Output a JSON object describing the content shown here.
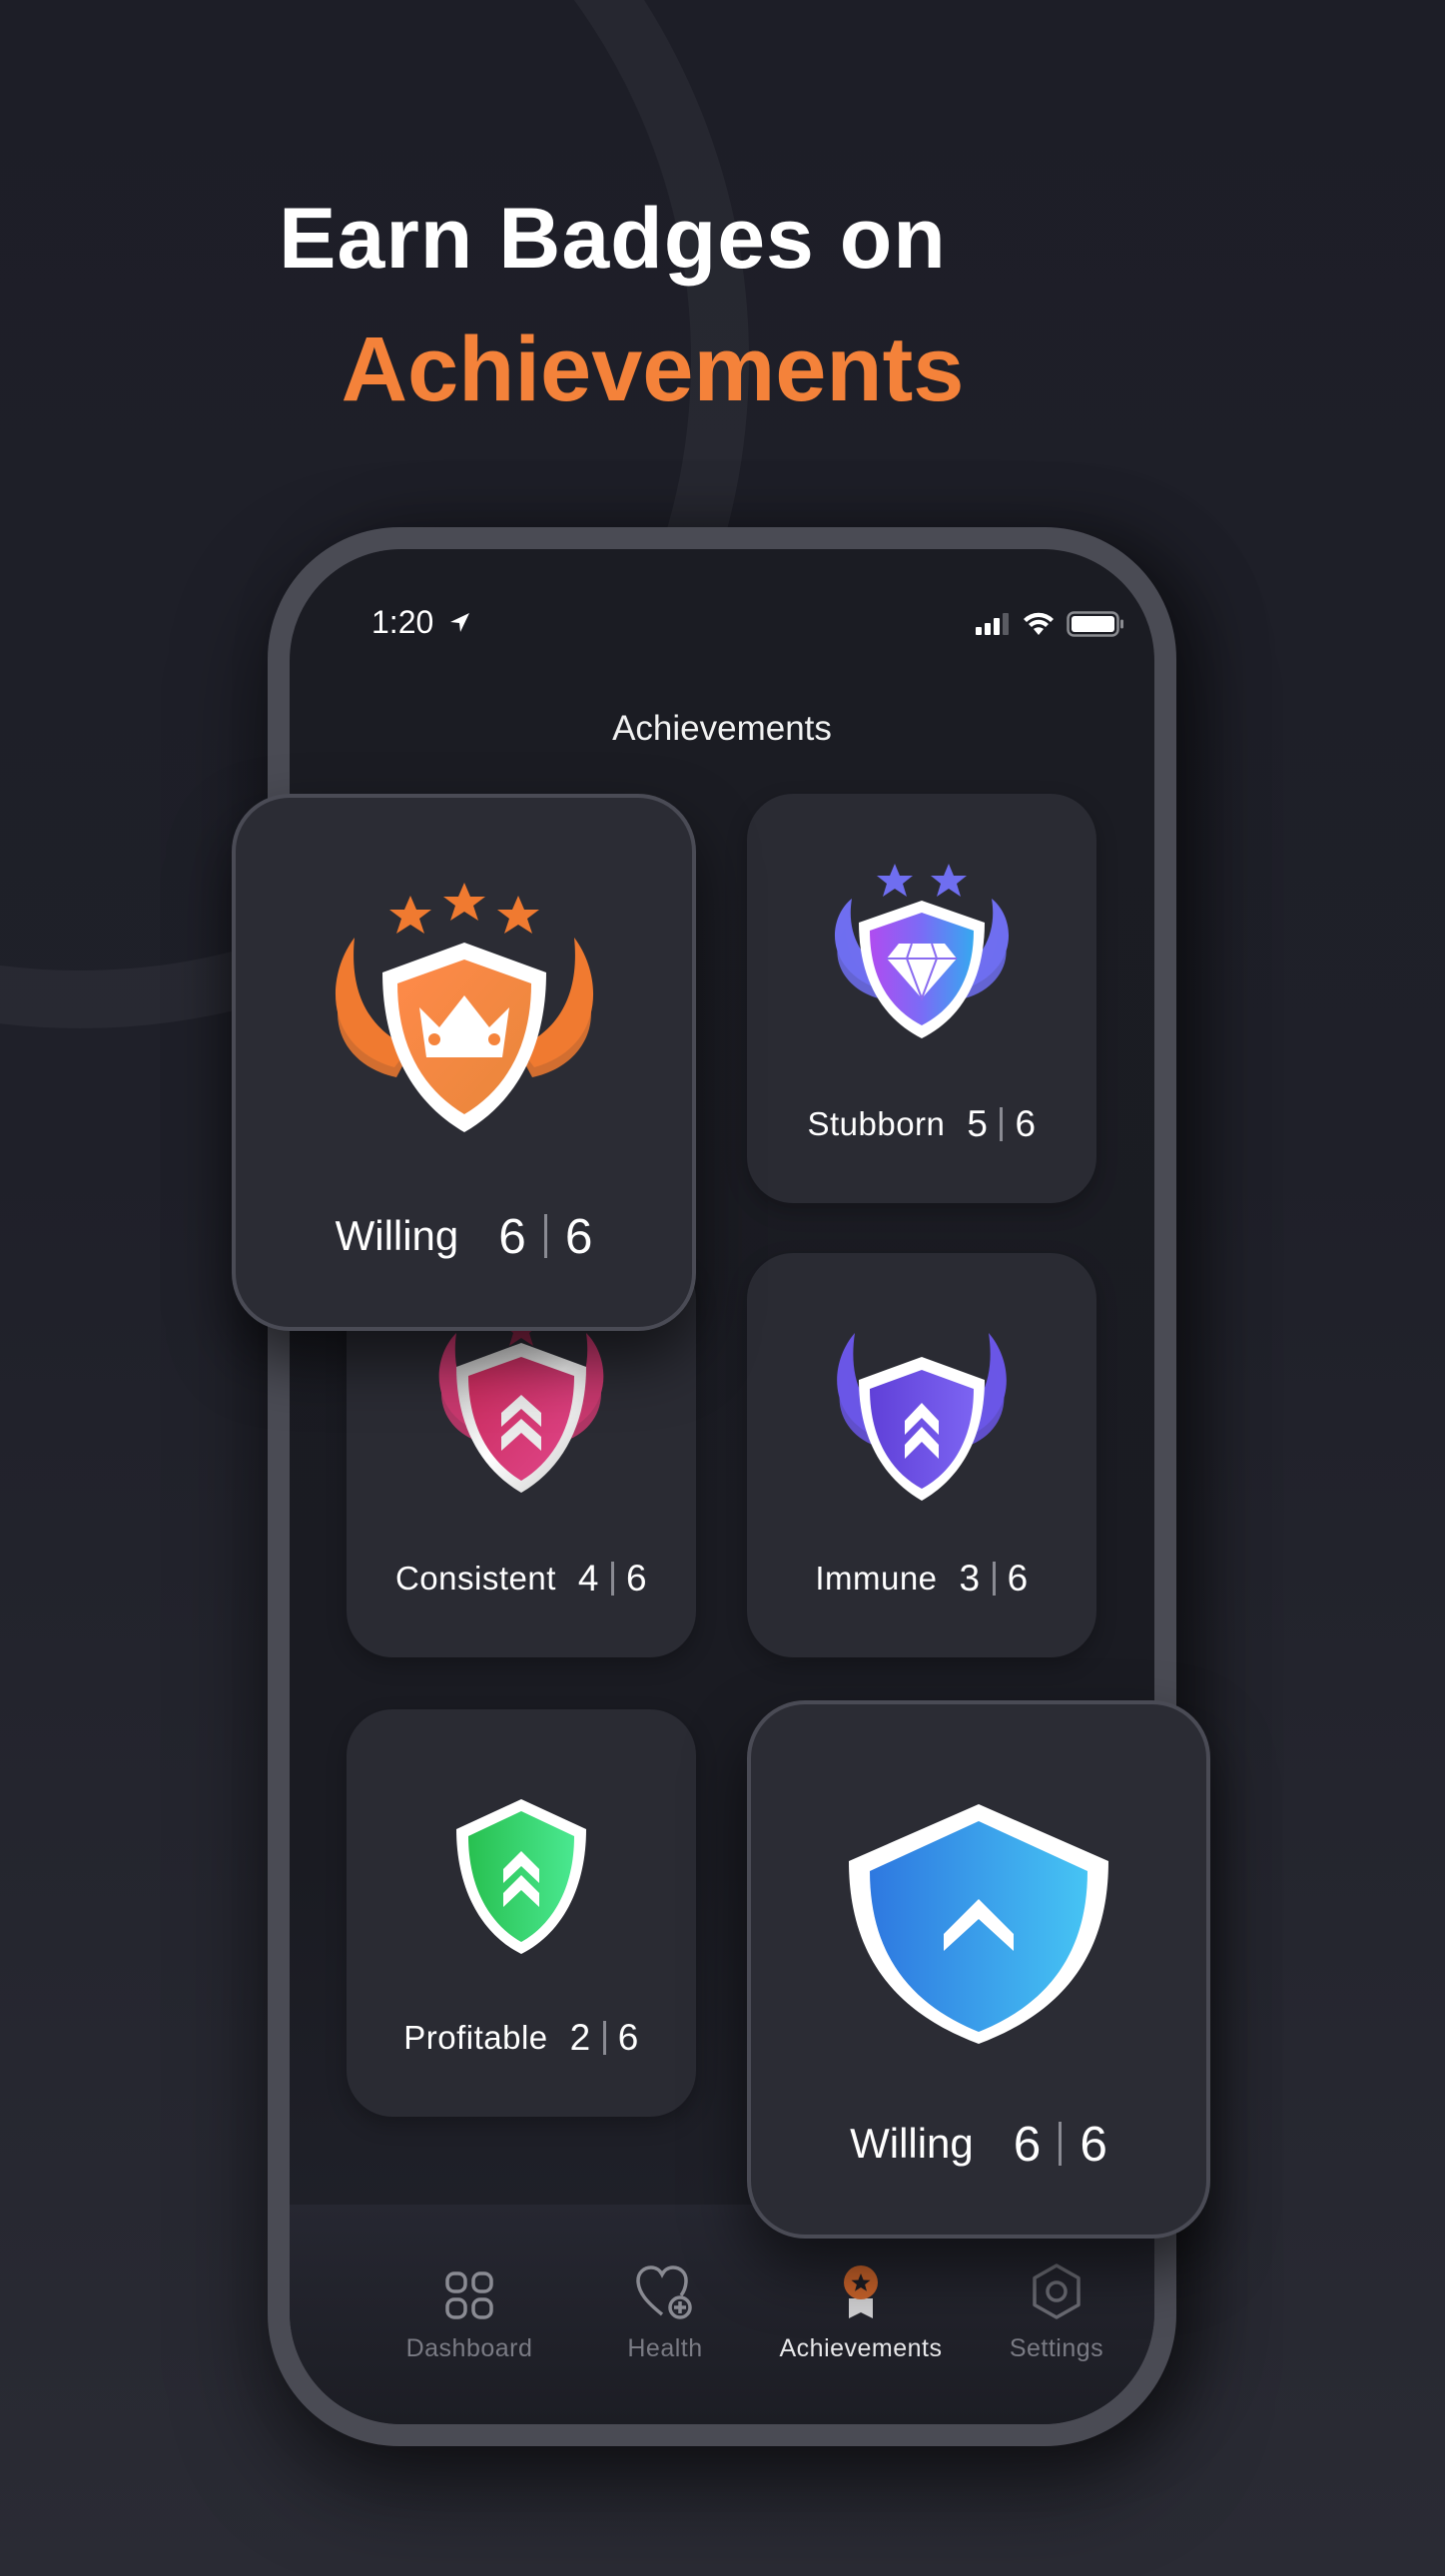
{
  "headline": {
    "line1": "Earn Badges on",
    "line2": "Achievements"
  },
  "colors": {
    "accent": "#f4823a",
    "background": "#1f2029",
    "card": "#2a2b33",
    "tab_inactive": "#7a7b84",
    "tab_active": "#e8e8ea"
  },
  "status_bar": {
    "time": "1:20",
    "location_icon": "location-arrow-icon",
    "signal_icon": "cellular-signal-icon",
    "wifi_icon": "wifi-icon",
    "battery_icon": "battery-icon"
  },
  "screen": {
    "title": "Achievements"
  },
  "badges": [
    {
      "name": "Willing",
      "earned": "6",
      "total": "6",
      "icon": "crown-shield-icon",
      "color": "#f4823a",
      "stars": 3,
      "featured": true
    },
    {
      "name": "Stubborn",
      "earned": "5",
      "total": "6",
      "icon": "diamond-shield-icon",
      "color": "#8a5cf5",
      "stars": 2,
      "featured": false
    },
    {
      "name": "Consistent",
      "earned": "4",
      "total": "6",
      "icon": "double-chevron-shield-icon",
      "color": "#d63a6e",
      "stars": 1,
      "featured": false
    },
    {
      "name": "Immune",
      "earned": "3",
      "total": "6",
      "icon": "double-chevron-shield-icon",
      "color": "#7052e0",
      "stars": 0,
      "featured": false
    },
    {
      "name": "Profitable",
      "earned": "2",
      "total": "6",
      "icon": "double-chevron-shield-icon",
      "color": "#2fc46a",
      "stars": 0,
      "featured": false
    },
    {
      "name": "Willing",
      "earned": "6",
      "total": "6",
      "icon": "chevron-shield-icon",
      "color": "#3a8fe0",
      "stars": 0,
      "featured": true
    }
  ],
  "tabbar": {
    "items": [
      {
        "label": "Dashboard",
        "icon": "dashboard-grid-icon",
        "active": false
      },
      {
        "label": "Health",
        "icon": "heart-plus-icon",
        "active": false
      },
      {
        "label": "Achievements",
        "icon": "medal-icon",
        "active": true
      },
      {
        "label": "Settings",
        "icon": "hexagon-gear-icon",
        "active": false
      }
    ]
  }
}
